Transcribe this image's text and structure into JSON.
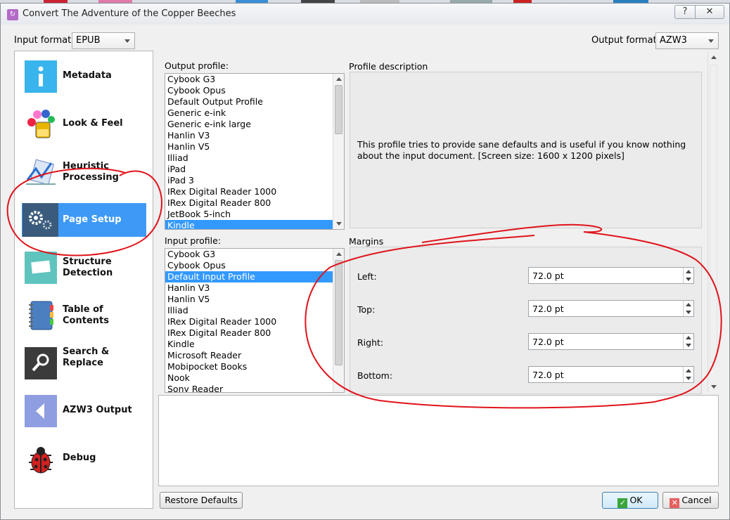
{
  "window": {
    "title": "Convert The Adventure of the Copper Beeches",
    "help_glyph": "?",
    "close_glyph": "✕",
    "app_glyph": "↻"
  },
  "formats": {
    "input_label": "Input format:",
    "input_value": "EPUB",
    "output_label": "Output format:",
    "output_value": "AZW3"
  },
  "sidebar": {
    "items": [
      {
        "label": "Metadata",
        "icon": "info-icon"
      },
      {
        "label": "Look & Feel",
        "icon": "paint-icon"
      },
      {
        "label": "Heuristic Processing",
        "icon": "heuristic-icon"
      },
      {
        "label": "Page Setup",
        "icon": "gears-icon",
        "selected": true
      },
      {
        "label": "Structure Detection",
        "icon": "structure-icon"
      },
      {
        "label": "Table of Contents",
        "icon": "book-icon"
      },
      {
        "label": "Search & Replace",
        "icon": "magnifier-icon"
      },
      {
        "label": "AZW3 Output",
        "icon": "back-arrow-icon"
      },
      {
        "label": "Debug",
        "icon": "ladybug-icon"
      }
    ]
  },
  "output_profile": {
    "label": "Output profile:",
    "items": [
      "Cybook G3",
      "Cybook Opus",
      "Default Output Profile",
      "Generic e-ink",
      "Generic e-ink large",
      "Hanlin V3",
      "Hanlin V5",
      "Illiad",
      "iPad",
      "iPad 3",
      "IRex Digital Reader 1000",
      "IRex Digital Reader 800",
      "JetBook 5-inch",
      "Kindle"
    ],
    "selected": "Kindle"
  },
  "input_profile": {
    "label": "Input profile:",
    "items": [
      "Cybook G3",
      "Cybook Opus",
      "Default Input Profile",
      "Hanlin V3",
      "Hanlin V5",
      "Illiad",
      "IRex Digital Reader 1000",
      "IRex Digital Reader 800",
      "Kindle",
      "Microsoft Reader",
      "Mobipocket Books",
      "Nook",
      "Sony Reader"
    ],
    "selected": "Default Input Profile"
  },
  "profile_description": {
    "label": "Profile description",
    "text": "This profile tries to provide sane defaults and is useful if you know nothing about the input document. [Screen size: 1600 x 1200 pixels]"
  },
  "margins": {
    "label": "Margins",
    "fields": [
      {
        "label": "Left:",
        "value": "72.0 pt"
      },
      {
        "label": "Top:",
        "value": "72.0 pt"
      },
      {
        "label": "Right:",
        "value": "72.0 pt"
      },
      {
        "label": "Bottom:",
        "value": "72.0 pt"
      }
    ]
  },
  "buttons": {
    "restore_defaults": "Restore Defaults",
    "ok": "OK",
    "cancel": "Cancel"
  },
  "colors": {
    "selection": "#3399ff",
    "annotation": "#e0131b"
  }
}
